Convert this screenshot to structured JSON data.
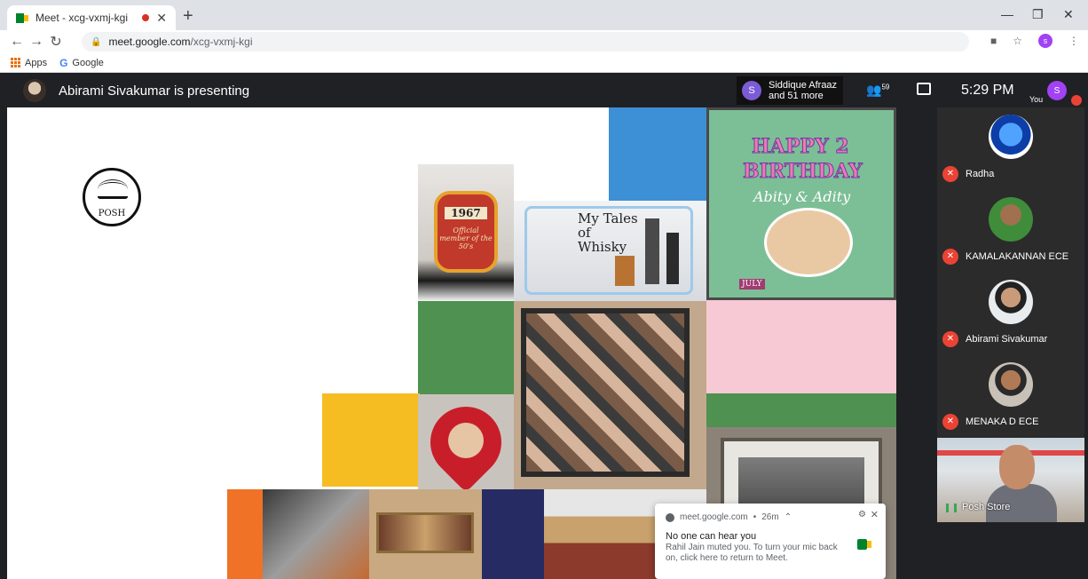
{
  "browser": {
    "tab_title": "Meet - xcg-vxmj-kgi",
    "url_host": "meet.google.com",
    "url_path": "/xcg-vxmj-kgi",
    "bookmarks": [
      {
        "label": "Apps",
        "icon": "apps-grid-icon"
      },
      {
        "label": "Google",
        "icon": "google-icon"
      }
    ],
    "profile_initial": "s"
  },
  "meet": {
    "presenting_text": "Abirami Sivakumar is presenting",
    "viewer_initial": "S",
    "viewer_line1": "Siddique Afraaz",
    "viewer_line2": "and 51 more",
    "people_count": "59",
    "time": "5:29 PM",
    "you_label": "You",
    "you_initial": "S",
    "participants": [
      {
        "name": "Radha",
        "muted": true
      },
      {
        "name": "KAMALAKANNAN ECE",
        "muted": true
      },
      {
        "name": "Abirami Sivakumar",
        "muted": true
      },
      {
        "name": "MENAKA D ECE",
        "muted": true
      }
    ],
    "camera_tile_name": "Posh Store"
  },
  "slide": {
    "logo_text": "POSH",
    "badge_year": "1967",
    "badge_text": "Official member of the 50's",
    "whisky_text": "My Tales of Whisky",
    "birthday_line1": "HAPPY 2",
    "birthday_line2": "BIRTHDAY",
    "birthday_names": "Abity & Adity",
    "birthday_month": "JULY",
    "colors": {
      "blue": "#3d8fd6",
      "green": "#4e9150",
      "pink": "#f7c9d4",
      "yellow": "#f5bd22",
      "orange": "#f07226",
      "navy": "#272b63"
    }
  },
  "notification": {
    "source": "meet.google.com",
    "age": "26m",
    "title": "No one can hear you",
    "body": "Rahil Jain muted you. To turn your mic back on, click here to return to Meet."
  }
}
